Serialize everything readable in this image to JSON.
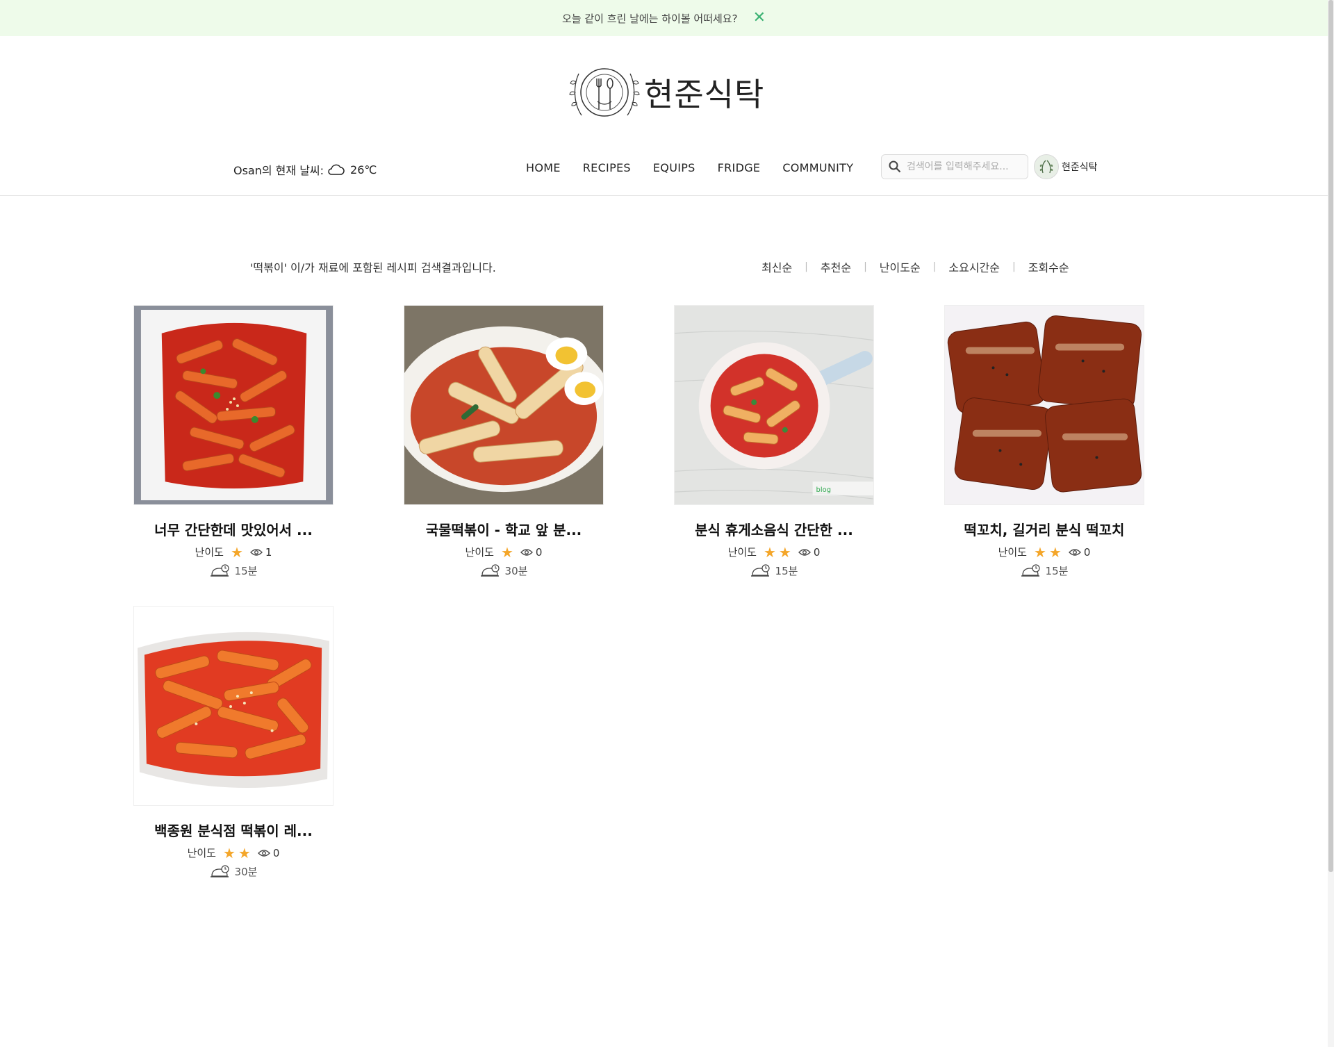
{
  "banner": {
    "message": "오늘 같이 흐린 날에는 하이볼 어떠세요?",
    "close_icon": "close-icon",
    "accent": "#3bb273",
    "background": "#eefbea"
  },
  "logo": {
    "text": "현준식탁"
  },
  "weather": {
    "label": "Osan의 현재 날씨:",
    "icon": "cloud-icon",
    "temperature": "26℃"
  },
  "nav": {
    "items": [
      "HOME",
      "RECIPES",
      "EQUIPS",
      "FRIDGE",
      "COMMUNITY"
    ]
  },
  "search": {
    "placeholder": "검색어를 입력해주세요...",
    "icon": "search-icon"
  },
  "user": {
    "name": "현준식탁"
  },
  "results": {
    "message": "'떡볶이' 이/가 재료에 포함된 레시피 검색결과입니다.",
    "sort_options": [
      "최신순",
      "추천순",
      "난이도순",
      "소요시간순",
      "조회수순"
    ]
  },
  "recipes": [
    {
      "title": "너무 간단한데 맛있어서 ...",
      "difficulty_label": "난이도",
      "difficulty": 1,
      "views": "1",
      "time": "15분",
      "image": "tteokbokki-plate"
    },
    {
      "title": "국물떡볶이 - 학교 앞 분...",
      "difficulty_label": "난이도",
      "difficulty": 1,
      "views": "0",
      "time": "30분",
      "image": "soup-tteokbokki-with-egg"
    },
    {
      "title": "분식 휴게소음식 간단한 ...",
      "difficulty_label": "난이도",
      "difficulty": 2,
      "views": "0",
      "time": "15분",
      "image": "tteokbokki-skillet"
    },
    {
      "title": "떡꼬치, 길거리 분식 떡꼬치",
      "difficulty_label": "난이도",
      "difficulty": 2,
      "views": "0",
      "time": "15분",
      "image": "tteok-skewers"
    },
    {
      "title": "백종원 분식점 떡볶이 레...",
      "difficulty_label": "난이도",
      "difficulty": 2,
      "views": "0",
      "time": "30분",
      "image": "tteokbokki-sesame"
    }
  ],
  "colors": {
    "star": "#f4a62a",
    "text": "#222222"
  }
}
